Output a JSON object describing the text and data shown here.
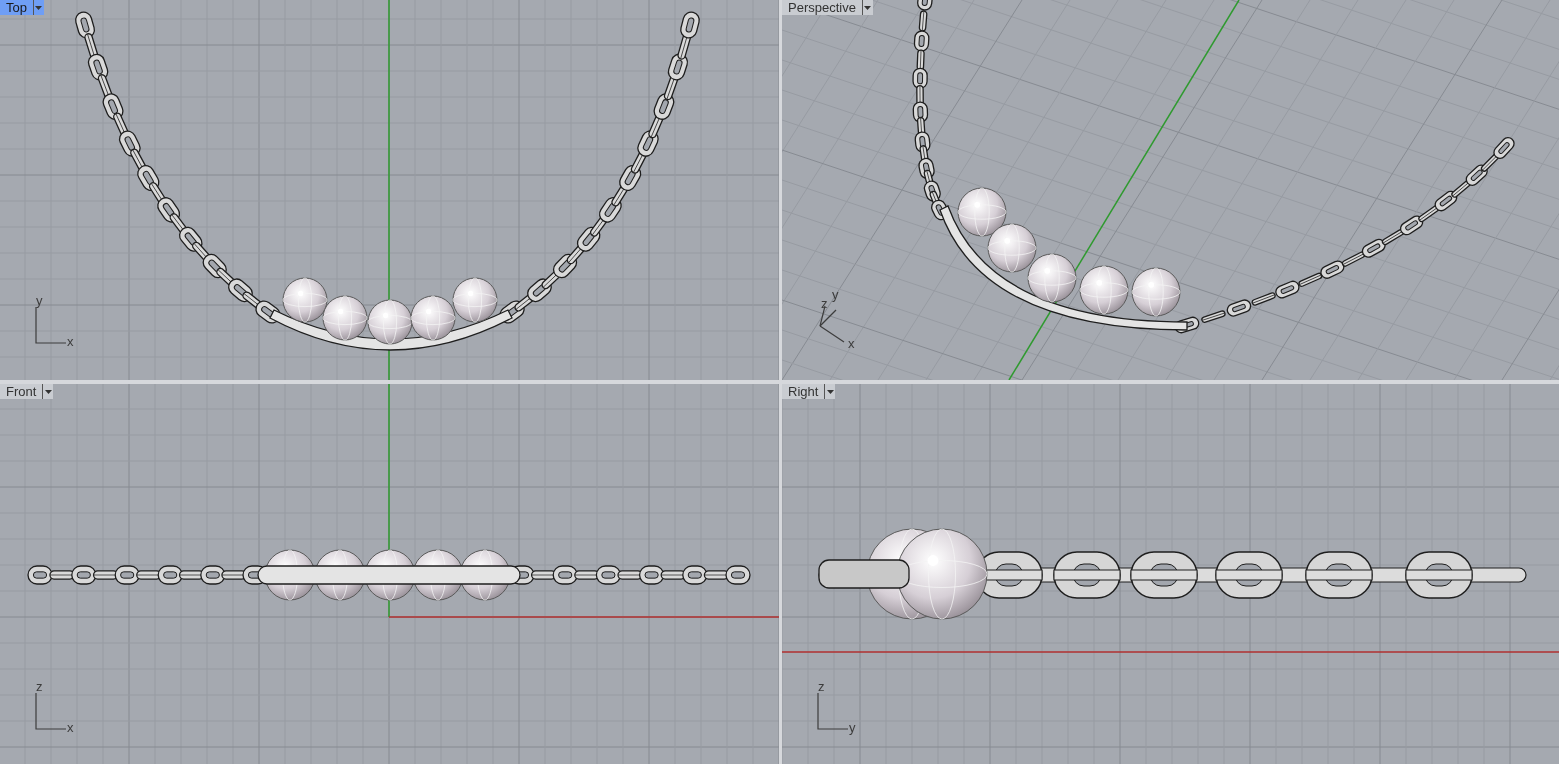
{
  "viewports": [
    {
      "kind": "top",
      "title": "Top",
      "selected": true,
      "axes": [
        "y",
        "x"
      ]
    },
    {
      "kind": "perspective",
      "title": "Perspective",
      "selected": false,
      "axes": [
        "z",
        "y",
        "x"
      ]
    },
    {
      "kind": "front",
      "title": "Front",
      "selected": false,
      "axes": [
        "z",
        "x"
      ]
    },
    {
      "kind": "right",
      "title": "Right",
      "selected": false,
      "axes": [
        "z",
        "y"
      ]
    }
  ]
}
